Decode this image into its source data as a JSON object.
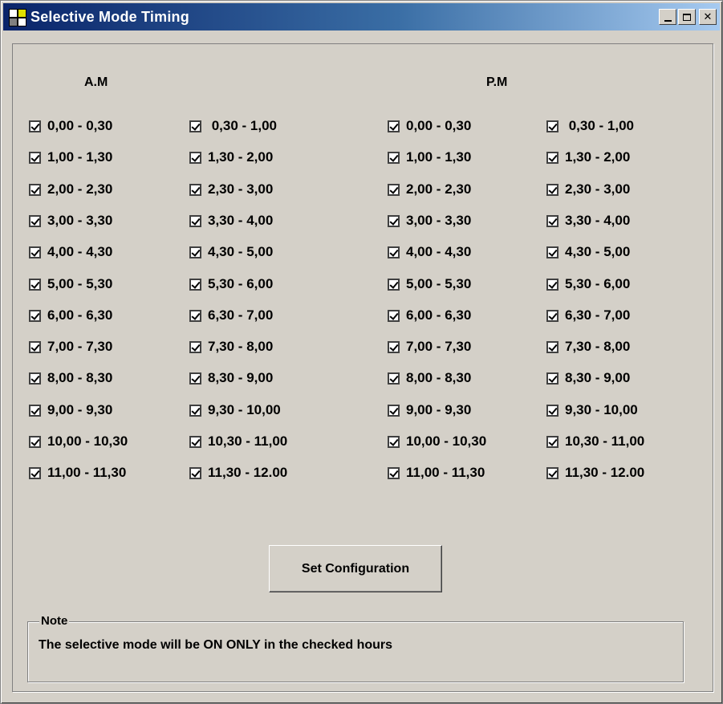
{
  "window": {
    "title": "Selective Mode Timing",
    "buttons": {
      "minimize": "minimize",
      "maximize": "maximize",
      "close": "✕"
    }
  },
  "headers": {
    "am": "A.M",
    "pm": "P.M"
  },
  "am": {
    "col1": [
      "0,00 - 0,30",
      "1,00 - 1,30",
      "2,00 - 2,30",
      "3,00 - 3,30",
      "4,00 - 4,30",
      "5,00 - 5,30",
      "6,00 - 6,30",
      "7,00 - 7,30",
      "8,00 - 8,30",
      "9,00 - 9,30",
      "10,00 - 10,30",
      "11,00 - 11,30"
    ],
    "col2": [
      " 0,30 - 1,00",
      "1,30 - 2,00",
      "2,30 - 3,00",
      "3,30 - 4,00",
      "4,30 - 5,00",
      "5,30 - 6,00",
      "6,30 - 7,00",
      "7,30 - 8,00",
      "8,30 - 9,00",
      "9,30 - 10,00",
      "10,30 - 11,00",
      "11,30 - 12.00"
    ]
  },
  "pm": {
    "col1": [
      "0,00 - 0,30",
      "1,00 - 1,30",
      "2,00 - 2,30",
      "3,00 - 3,30",
      "4,00 - 4,30",
      "5,00 - 5,30",
      "6,00 - 6,30",
      "7,00 - 7,30",
      "8,00 - 8,30",
      "9,00 - 9,30",
      "10,00 - 10,30",
      "11,00 - 11,30"
    ],
    "col2": [
      " 0,30 - 1,00",
      "1,30 - 2,00",
      "2,30 - 3,00",
      "3,30 - 4,00",
      "4,30 - 5,00",
      "5,30 - 6,00",
      "6,30 - 7,00",
      "7,30 - 8,00",
      "8,30 - 9,00",
      "9,30 - 10,00",
      "10,30 - 11,00",
      "11,30 - 12.00"
    ]
  },
  "checked": true,
  "set_button": "Set Configuration",
  "note": {
    "legend": "Note",
    "text": "The selective mode will be ON ONLY in the checked hours"
  },
  "colors": {
    "titlebar_start": "#0a246a",
    "titlebar_end": "#a6caf0",
    "face": "#d4d0c8"
  }
}
